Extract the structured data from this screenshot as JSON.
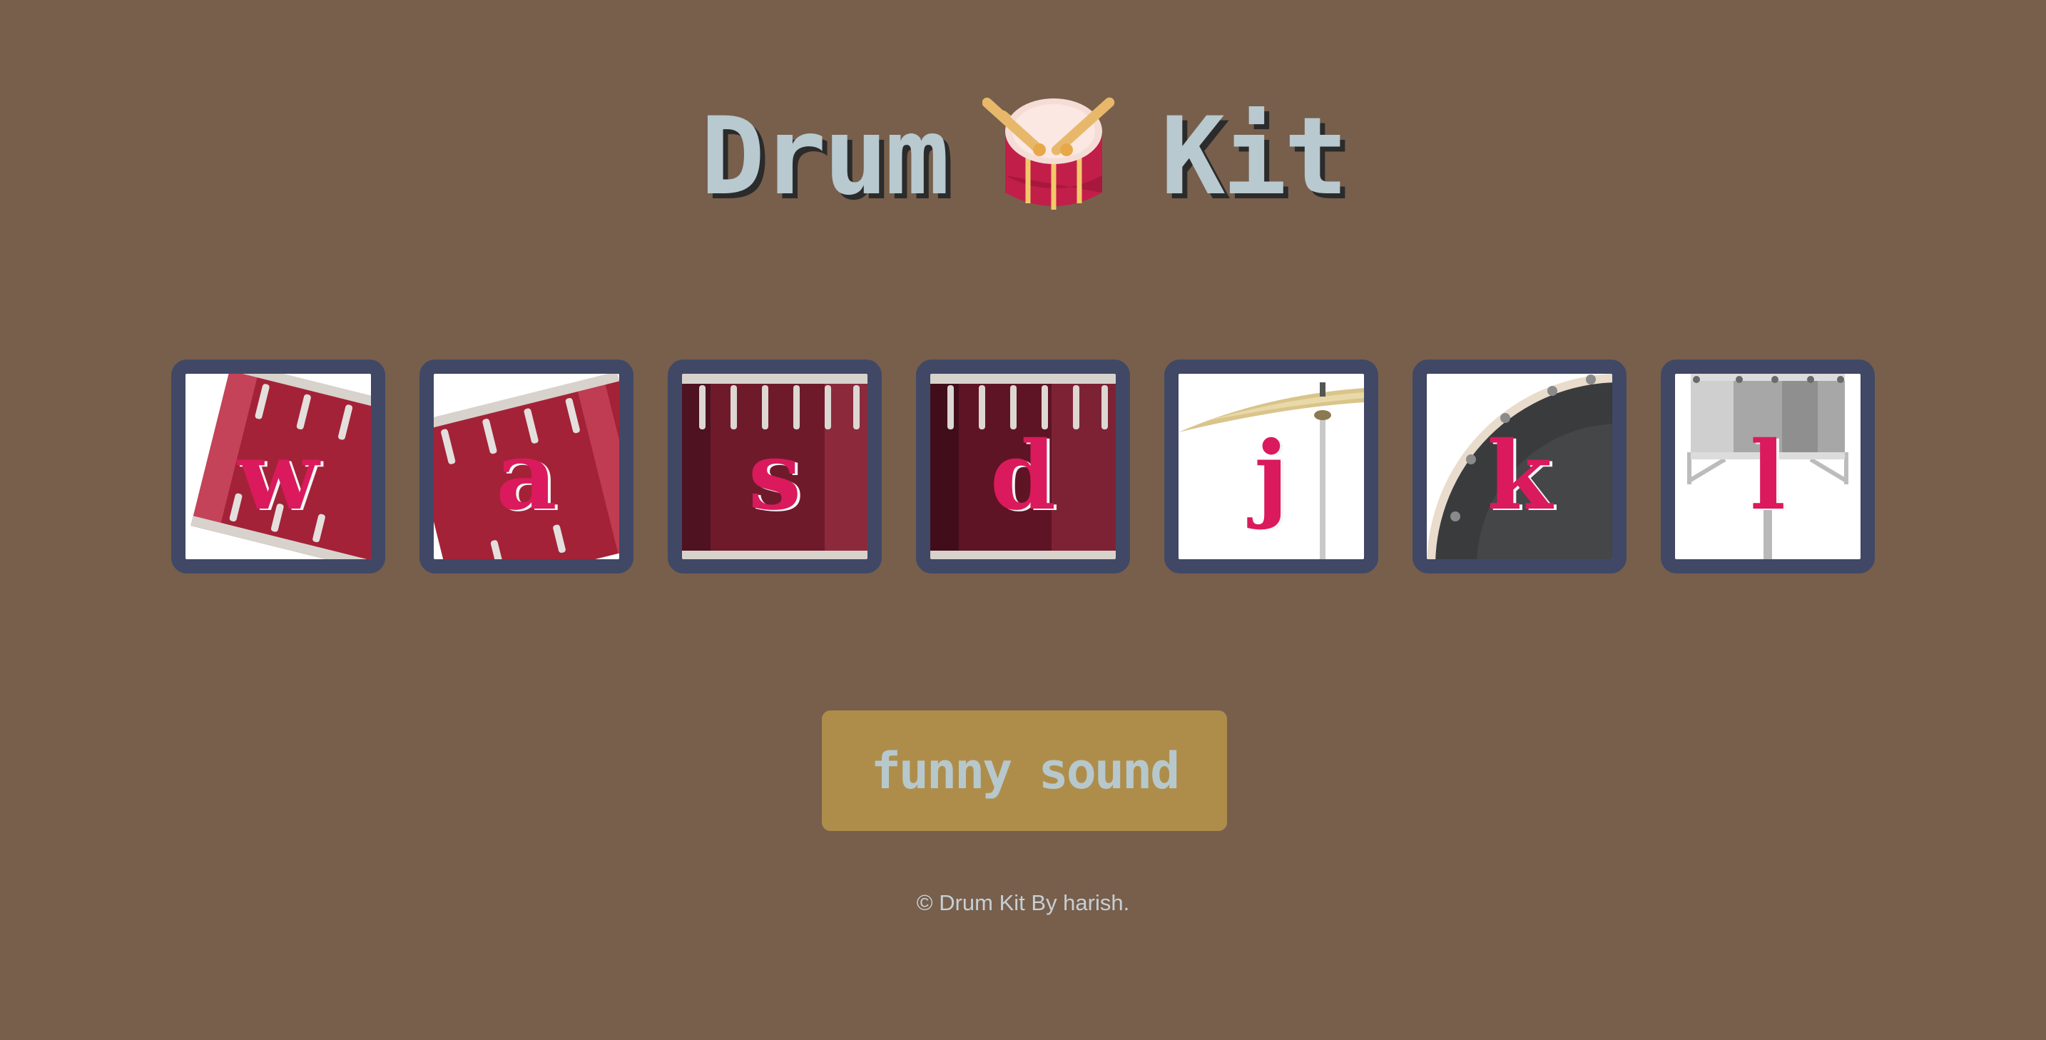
{
  "title": {
    "word1": "Drum",
    "word2": "Kit",
    "logo_icon": "drum-with-sticks-icon"
  },
  "drums": [
    {
      "key": "w",
      "instrument": "tom-icon"
    },
    {
      "key": "a",
      "instrument": "tom-icon"
    },
    {
      "key": "s",
      "instrument": "tom-icon"
    },
    {
      "key": "d",
      "instrument": "tom-icon"
    },
    {
      "key": "j",
      "instrument": "cymbal-icon"
    },
    {
      "key": "k",
      "instrument": "kick-drum-icon"
    },
    {
      "key": "l",
      "instrument": "snare-icon"
    }
  ],
  "funny_button": {
    "label": "funny sound"
  },
  "footer": {
    "text": "© Drum Kit By harish."
  },
  "colors": {
    "background": "#775f4c",
    "title_text": "#b8c9cf",
    "drum_border": "#404866",
    "key_letter": "#da1a5c",
    "button_background": "#ae8d4b",
    "button_text": "#b7c8cc",
    "footer_text": "#c6cfd4"
  }
}
